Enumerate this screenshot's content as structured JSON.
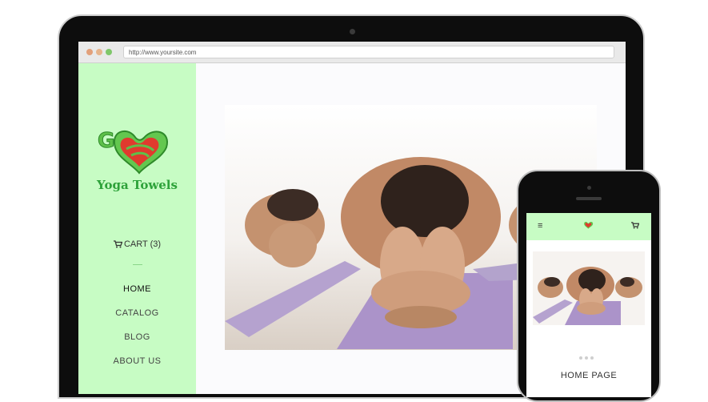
{
  "browser": {
    "url": "http://www.yoursite.com"
  },
  "logo": {
    "go_text": "GO",
    "brand_name": "Yoga Towels",
    "colors": {
      "green": "#2ea23a",
      "red": "#e03a2e"
    }
  },
  "sidebar": {
    "background": "#c7fcc4",
    "cart_label": "CART (3)",
    "nav": [
      "HOME",
      "CATALOG",
      "BLOG",
      "ABOUT US"
    ]
  },
  "hero": {
    "subject": "group of people in yoga forward-fold pose on purple mats"
  },
  "phone": {
    "page_title": "HOME PAGE",
    "menu_icon": "hamburger-icon",
    "cart_icon": "cart-icon"
  }
}
